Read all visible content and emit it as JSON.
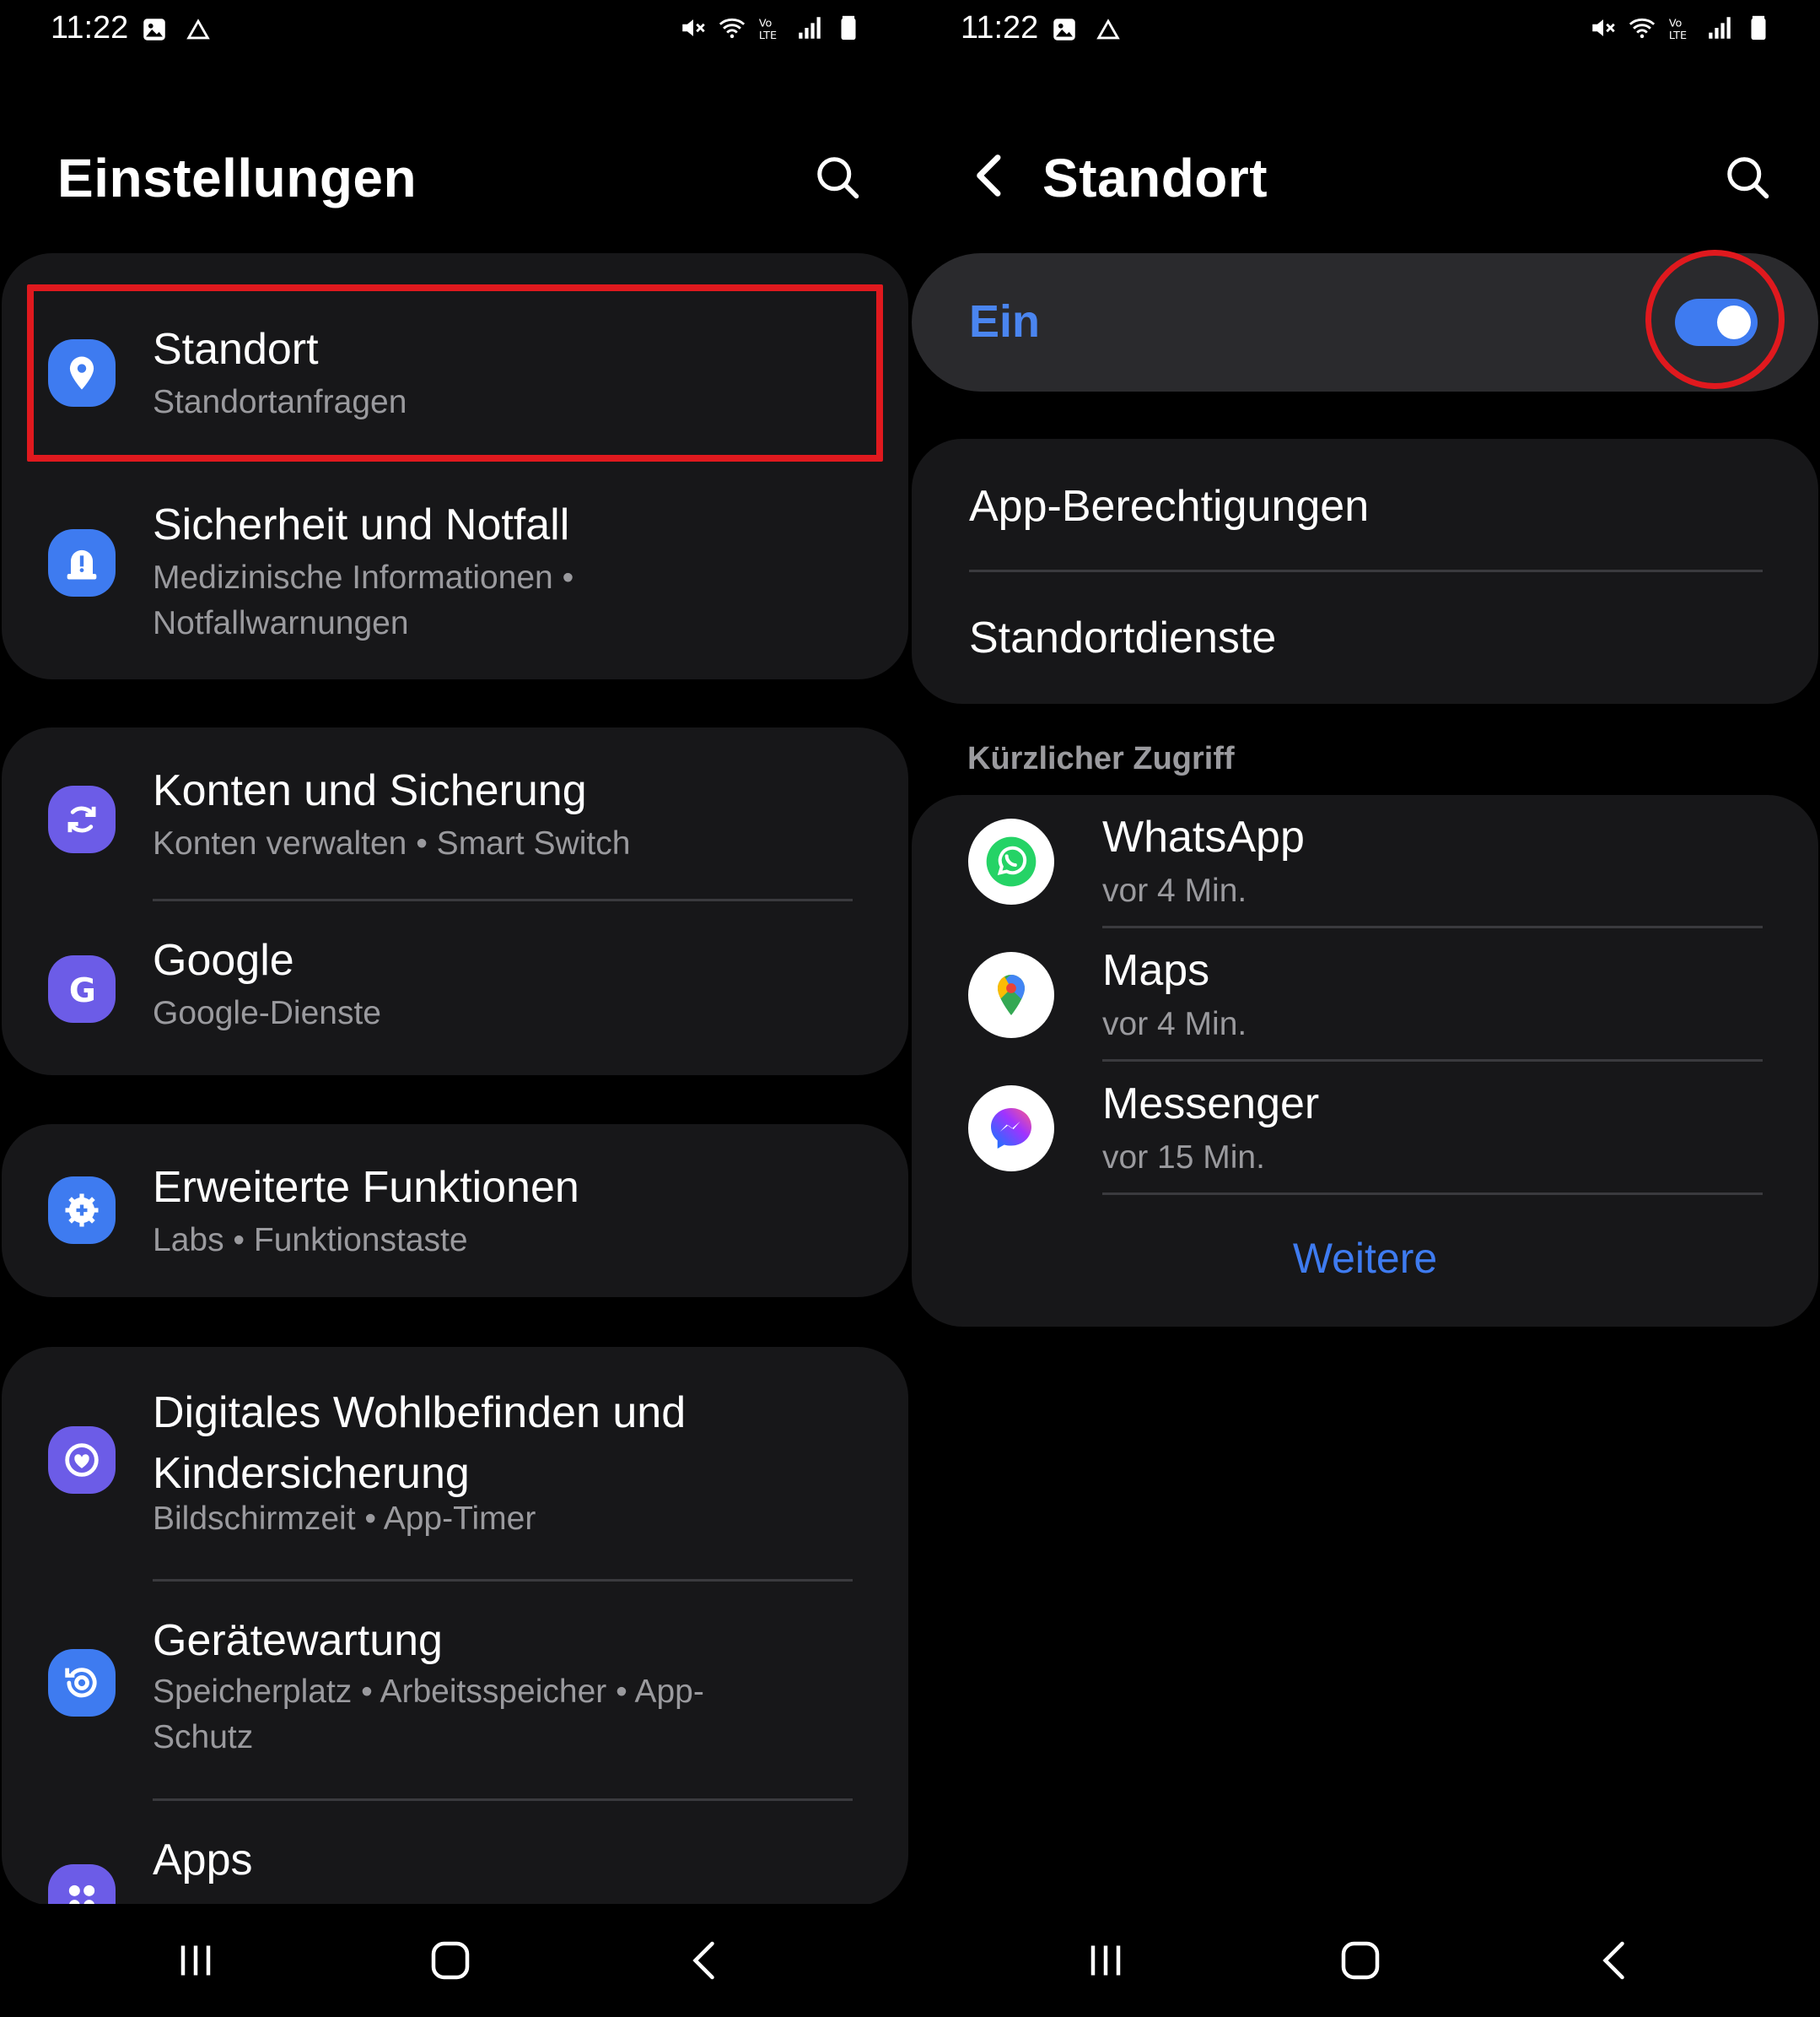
{
  "left": {
    "status": {
      "time": "11:22"
    },
    "header": {
      "title": "Einstellungen"
    },
    "items": [
      {
        "title": "Standort",
        "subtitle": "Standortanfragen"
      },
      {
        "title": "Sicherheit und Notfall",
        "subtitle": "Medizinische Informationen  •  Notfallwarnungen"
      },
      {
        "title": "Konten und Sicherung",
        "subtitle": "Konten verwalten  •  Smart Switch"
      },
      {
        "title": "Google",
        "subtitle": "Google-Dienste"
      },
      {
        "title": "Erweiterte Funktionen",
        "subtitle": "Labs  •  Funktionstaste"
      },
      {
        "title": "Digitales Wohlbefinden und Kindersicherung",
        "subtitle": "Bildschirmzeit  •  App-Timer"
      },
      {
        "title": "Gerätewartung",
        "subtitle": "Speicherplatz  •  Arbeitsspeicher  •  App-Schutz"
      },
      {
        "title": "Apps",
        "subtitle": ""
      }
    ]
  },
  "right": {
    "status": {
      "time": "11:22"
    },
    "header": {
      "title": "Standort"
    },
    "toggle": {
      "label": "Ein",
      "state": "on"
    },
    "menu": [
      {
        "label": "App-Berechtigungen"
      },
      {
        "label": "Standortdienste"
      }
    ],
    "recent": {
      "section_label": "Kürzlicher Zugriff",
      "apps": [
        {
          "name": "WhatsApp",
          "time": "vor 4 Min."
        },
        {
          "name": "Maps",
          "time": "vor 4 Min."
        },
        {
          "name": "Messenger",
          "time": "vor 15 Min."
        }
      ],
      "more_label": "Weitere"
    }
  },
  "colors": {
    "accent": "#3e7bf0",
    "highlight": "#e0191e",
    "card_bg": "#171719",
    "secondary_text": "#9a9a9e"
  }
}
